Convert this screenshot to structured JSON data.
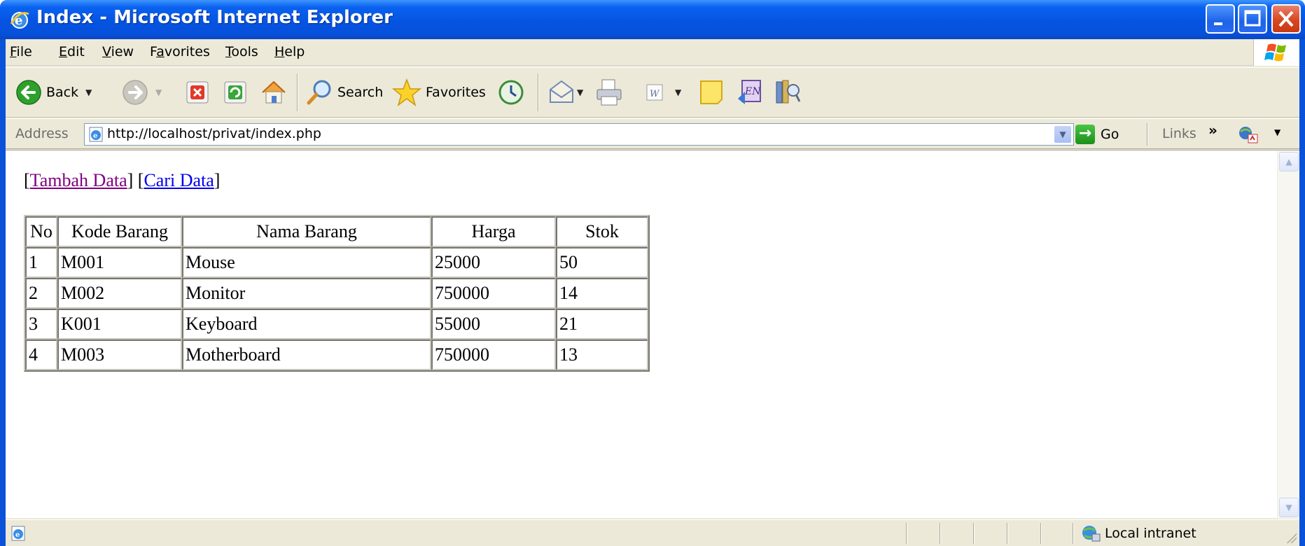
{
  "window": {
    "title": "Index - Microsoft Internet Explorer"
  },
  "menu": [
    {
      "pre": "",
      "acc": "F",
      "post": "ile"
    },
    {
      "pre": "",
      "acc": "E",
      "post": "dit"
    },
    {
      "pre": "",
      "acc": "V",
      "post": "iew"
    },
    {
      "pre": "F",
      "acc": "a",
      "post": "vorites"
    },
    {
      "pre": "",
      "acc": "T",
      "post": "ools"
    },
    {
      "pre": "",
      "acc": "H",
      "post": "elp"
    }
  ],
  "toolbar": {
    "back_label": "Back",
    "search_label": "Search",
    "favorites_label": "Favorites"
  },
  "address": {
    "label": "Address",
    "url": "http://localhost/privat/index.php",
    "go_label": "Go",
    "links_label": "Links",
    "links_chevron": "»"
  },
  "page": {
    "links": [
      {
        "label": "Tambah Data",
        "visited": true
      },
      {
        "label": "Cari Data",
        "visited": false
      }
    ],
    "table": {
      "headers": [
        "No",
        "Kode Barang",
        "Nama Barang",
        "Harga",
        "Stok"
      ],
      "rows": [
        [
          "1",
          "M001",
          "Mouse",
          "25000",
          "50"
        ],
        [
          "2",
          "M002",
          "Monitor",
          "750000",
          "14"
        ],
        [
          "3",
          "K001",
          "Keyboard",
          "55000",
          "21"
        ],
        [
          "4",
          "M003",
          "Motherboard",
          "750000",
          "13"
        ]
      ]
    }
  },
  "status": {
    "zone_label": "Local intranet"
  },
  "colors": {
    "titlebar": "#0554e1",
    "chrome": "#ece9d8",
    "link_visited": "#800080",
    "link_unvisited": "#0000ee"
  },
  "icons": [
    "ie-logo-icon",
    "minimize-icon",
    "maximize-icon",
    "close-icon",
    "windows-flag-icon",
    "back-icon",
    "forward-icon",
    "stop-icon",
    "refresh-icon",
    "home-icon",
    "search-icon",
    "favorites-star-icon",
    "history-icon",
    "mail-icon",
    "print-icon",
    "edit-word-icon",
    "discuss-icon",
    "messenger-icon",
    "research-icon",
    "page-icon",
    "go-arrow-icon",
    "msn-icon",
    "intranet-globe-icon"
  ]
}
